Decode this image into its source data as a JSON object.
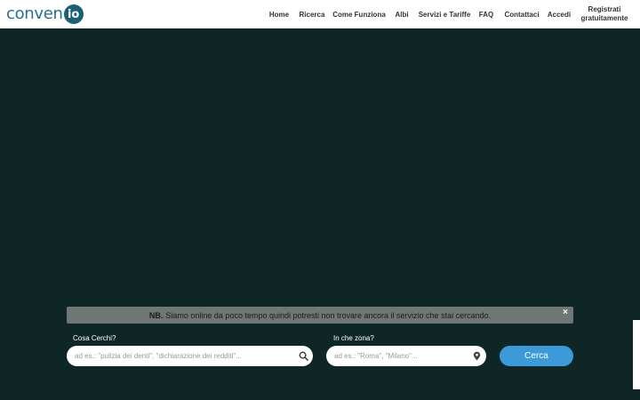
{
  "logo": {
    "text": "conven",
    "circle": "io"
  },
  "nav": {
    "items": [
      {
        "label": "Home"
      },
      {
        "label": "Ricerca"
      },
      {
        "label": "Come Funziona"
      },
      {
        "label": "Albi"
      },
      {
        "label": "Servizi e Tariffe"
      },
      {
        "label": "FAQ"
      },
      {
        "label": "Contattaci"
      },
      {
        "label": "Accedi"
      },
      {
        "label": "Registrati gratuitamente"
      }
    ]
  },
  "notice": {
    "prefix": "NB.",
    "text": "Siamo online da poco tempo quindi potresti non trovare ancora il servizio che stai cercando.",
    "close": "×"
  },
  "search": {
    "what_label": "Cosa Cerchi?",
    "what_placeholder": "ad es.: \"pulizia dei denti\", \"dichiarazione dei redditi\"...",
    "where_label": "In che zona?",
    "where_placeholder": "ad es.: \"Roma\", \"Milano\"...",
    "button_label": "Cerca"
  },
  "icons": {
    "search": "search-icon",
    "location": "map-pin-icon"
  },
  "colors": {
    "hero_bg": "#0f2626",
    "accent": "#3c9ad8",
    "logo": "#1e5f78"
  }
}
